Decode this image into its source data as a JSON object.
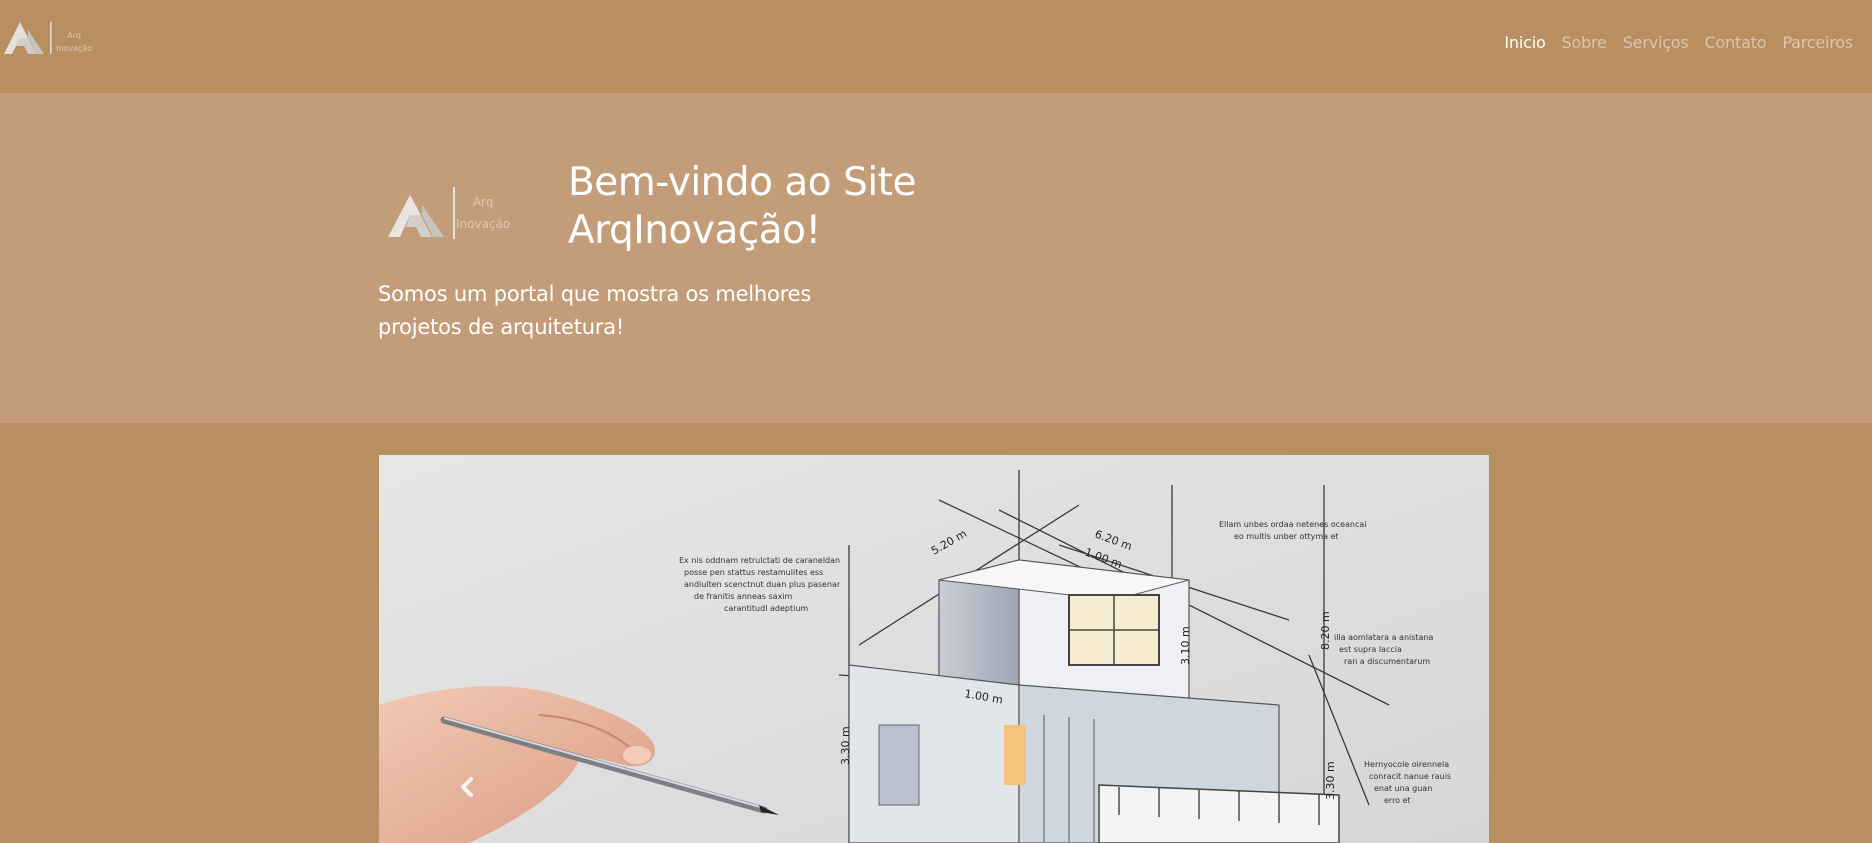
{
  "brand": {
    "name_line1": "Arq",
    "name_line2": "Inovação"
  },
  "nav": {
    "items": [
      {
        "label": "Inicio",
        "active": true
      },
      {
        "label": "Sobre",
        "active": false
      },
      {
        "label": "Serviços",
        "active": false
      },
      {
        "label": "Contato",
        "active": false
      },
      {
        "label": "Parceiros",
        "active": false
      }
    ]
  },
  "hero": {
    "logo_line1": "Arq",
    "logo_line2": "Inovação",
    "title": "Bem-vindo ao Site ArqInovação!",
    "subtitle": "Somos um portal que mostra os melhores projetos de arquitetura!"
  },
  "carousel": {
    "slide_annotations": {
      "dim_a": "5.20 m",
      "dim_b": "6.20 m",
      "dim_c": "1.00 m",
      "dim_d": "3.10 m",
      "dim_e": "8.20 m",
      "dim_f": "1.00 m",
      "dim_g": "3.30 m",
      "dim_h": "3.30 m"
    },
    "prev_icon": "chevron-left-icon"
  },
  "colors": {
    "navbar_bg": "#b98f62",
    "hero_bg": "#c39d7a",
    "page_bg": "#b98f62",
    "nav_active": "#ffffff",
    "nav_inactive": "#dcc5ab"
  }
}
